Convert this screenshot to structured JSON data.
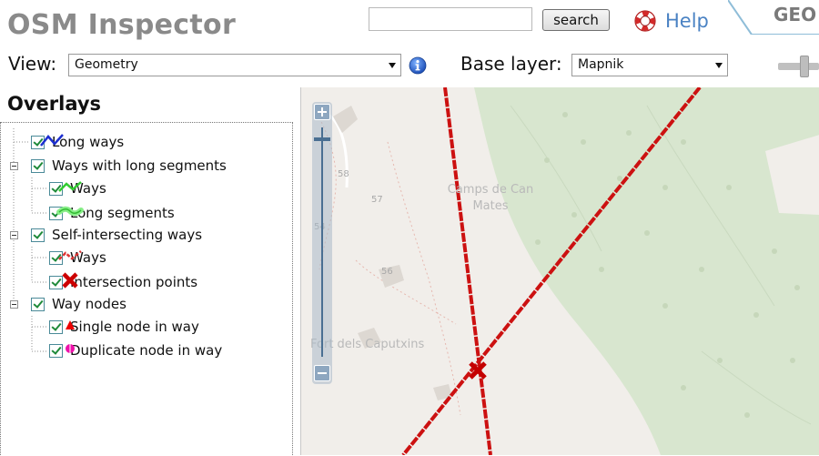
{
  "header": {
    "title": "OSM Inspector",
    "search": {
      "value": "",
      "placeholder": "",
      "button_label": "search"
    },
    "help_label": "Help",
    "geo_tab_label": "GEO"
  },
  "toolbar": {
    "view_label": "View:",
    "view_selected": "Geometry",
    "base_layer_label": "Base layer:",
    "base_layer_selected": "Mapnik"
  },
  "overlays": {
    "heading": "Overlays",
    "items": [
      {
        "label": "Long ways",
        "icon": "long-ways-line-icon",
        "color": "#1c2ed0"
      },
      {
        "label": "Ways with long segments",
        "icon": null
      },
      {
        "label": "Ways",
        "icon": "green-line-icon",
        "color": "#33cc33"
      },
      {
        "label": "Long segments",
        "icon": "green-wide-line-icon",
        "color": "#66ee66"
      },
      {
        "label": "Self-intersecting ways",
        "icon": null
      },
      {
        "label": "Ways",
        "icon": "red-dashed-line-icon",
        "color": "#dd3333"
      },
      {
        "label": "Intersection points",
        "icon": "red-cross-icon",
        "color": "#cc0000"
      },
      {
        "label": "Way nodes",
        "icon": null
      },
      {
        "label": "Single node in way",
        "icon": "red-triangle-icon",
        "color": "#ee0000"
      },
      {
        "label": "Duplicate node in way",
        "icon": "magenta-circle-icon",
        "color": "#ee11aa"
      }
    ]
  },
  "map": {
    "places": {
      "camps": "Camps de Can Mates",
      "fort": "Fort dels Caputxins"
    },
    "house_numbers": [
      "58",
      "57",
      "56",
      "54"
    ]
  },
  "colors": {
    "title": "#8a8a8a",
    "help": "#4a82c3",
    "forest": "#d8e6cf",
    "way_red": "#cc1111"
  }
}
